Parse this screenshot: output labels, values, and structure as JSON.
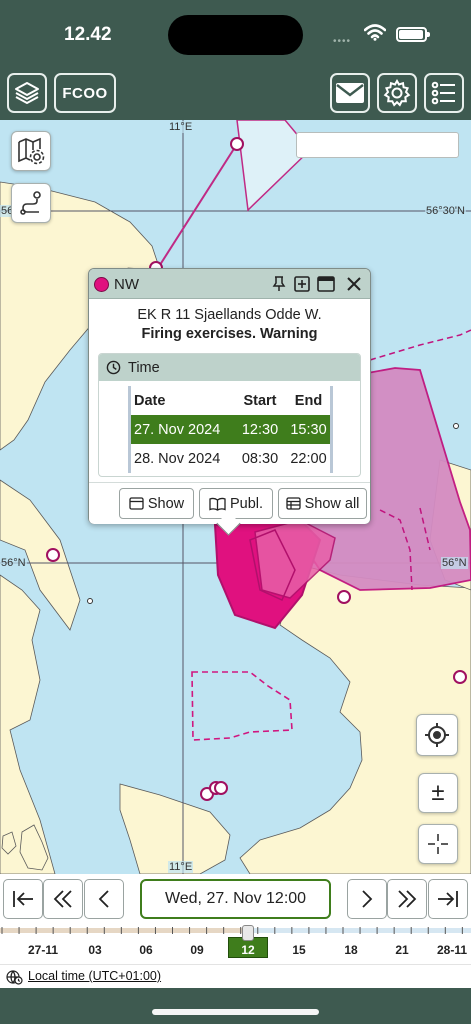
{
  "status_bar": {
    "time": "12.42",
    "signal_dots": "••••"
  },
  "top_bar": {
    "fcoo_label": "FCOO"
  },
  "map": {
    "labels": {
      "lon_top": "11°E",
      "lon_bottom": "11°E",
      "lat_right_top": "56°30'N",
      "lat_left_top": "56",
      "lat_right_mid": "56°N",
      "lat_left_mid": "56°N"
    },
    "zoom_label": "±"
  },
  "popup": {
    "header_title": "NW",
    "line1": "EK R 11 Sjaellands Odde W.",
    "line2": "Firing exercises. Warning",
    "time_panel_title": "Time",
    "table": {
      "headers": [
        "Date",
        "Start",
        "End"
      ],
      "rows": [
        {
          "date": "27. Nov 2024",
          "start": "12:30",
          "end": "15:30",
          "active": true
        },
        {
          "date": "28. Nov 2024",
          "start": "08:30",
          "end": "22:00",
          "active": false
        }
      ]
    },
    "buttons": {
      "show": "Show",
      "publ": "Publ.",
      "show_all": "Show all"
    },
    "accent_color": "#e0117f"
  },
  "time_nav": {
    "current": "Wed, 27. Nov 12:00"
  },
  "timeline": {
    "labels": [
      "27-11",
      "03",
      "06",
      "09",
      "12",
      "15",
      "18",
      "21",
      "28-11"
    ],
    "current": "12"
  },
  "timezone": {
    "label": "Local time (UTC+01:00)"
  }
}
